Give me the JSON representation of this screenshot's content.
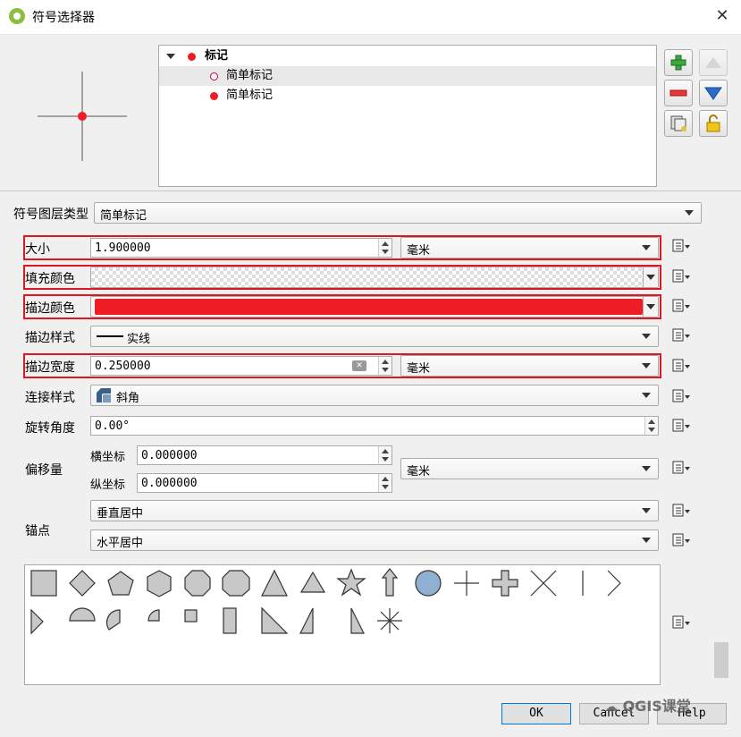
{
  "window": {
    "title": "符号选择器",
    "close_icon": "close-icon"
  },
  "tree": {
    "root_label": "标记",
    "children": [
      {
        "label": "简单标记"
      },
      {
        "label": "简单标记"
      }
    ]
  },
  "layer_type": {
    "label": "符号图层类型",
    "value": "简单标记"
  },
  "properties": {
    "size": {
      "label": "大小",
      "value": "1.900000",
      "unit": "毫米"
    },
    "fill_color": {
      "label": "填充颜色",
      "value": "transparent"
    },
    "stroke_color": {
      "label": "描边颜色",
      "value": "#ee1c25"
    },
    "stroke_style": {
      "label": "描边样式",
      "value": "实线"
    },
    "stroke_width": {
      "label": "描边宽度",
      "value": "0.250000",
      "unit": "毫米"
    },
    "join_style": {
      "label": "连接样式",
      "value": "斜角"
    },
    "rotation": {
      "label": "旋转角度",
      "value": "0.00°"
    },
    "offset": {
      "label": "偏移量",
      "x_label": "横坐标",
      "x_value": "0.000000",
      "y_label": "纵坐标",
      "y_value": "0.000000",
      "unit": "毫米"
    },
    "anchor": {
      "label": "锚点",
      "vertical": "垂直居中",
      "horizontal": "水平居中"
    }
  },
  "marker_shapes": [
    "square",
    "diamond",
    "pentagon",
    "hexagon",
    "octagon",
    "decagon",
    "triangle",
    "equilateral-triangle",
    "star",
    "arrow",
    "circle",
    "cross",
    "cross-fill",
    "x",
    "line",
    "arrowhead",
    "filled-arrowhead",
    "semicircle",
    "third-circle",
    "quarter-circle",
    "quarter-square",
    "half-square",
    "diagonal-half-square",
    "right-half-triangle",
    "left-half-triangle",
    "asterisk"
  ],
  "buttons": {
    "ok": "OK",
    "cancel": "Cancel",
    "help": "Help"
  },
  "watermark": "QGIS课堂"
}
